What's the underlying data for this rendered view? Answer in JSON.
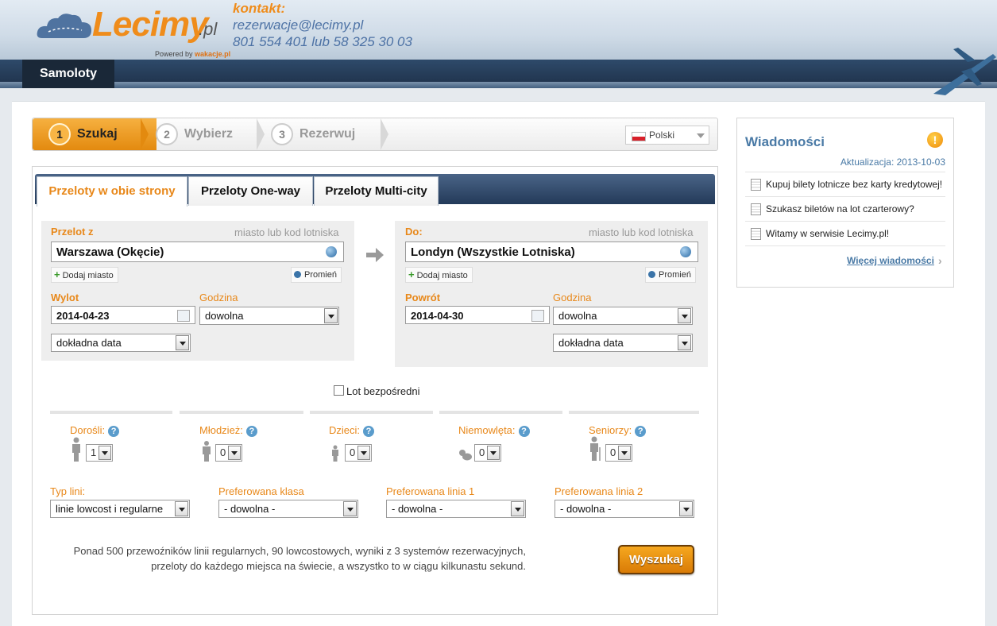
{
  "header": {
    "logo_text": "Lecimy",
    "logo_suffix": ".pl",
    "powered_by": "Powered by",
    "powered_brand": "wakacje.pl",
    "contact_label": "kontakt:",
    "contact_email": "rezerwacje@lecimy.pl",
    "contact_phones": "801 554 401 lub 58 325 30 03"
  },
  "nav": {
    "active_tab": "Samoloty"
  },
  "steps": [
    {
      "num": "1",
      "label": "Szukaj",
      "active": true
    },
    {
      "num": "2",
      "label": "Wybierz",
      "active": false
    },
    {
      "num": "3",
      "label": "Rezerwuj",
      "active": false
    }
  ],
  "language": {
    "selected": "Polski"
  },
  "tabs": [
    "Przeloty w obie strony",
    "Przeloty One-way",
    "Przeloty Multi-city"
  ],
  "from": {
    "label": "Przelot z",
    "hint": "miasto lub kod lotniska",
    "value": "Warszawa (Okęcie)",
    "add_city": "Dodaj miasto",
    "swap": "Promień",
    "date_label": "Wylot",
    "date_value": "2014-04-23",
    "time_label": "Godzina",
    "time_value": "dowolna",
    "precision_value": "dokładna data"
  },
  "to": {
    "label": "Do:",
    "hint": "miasto lub kod lotniska",
    "value": "Londyn (Wszystkie Lotniska)",
    "add_city": "Dodaj miasto",
    "swap": "Promień",
    "date_label": "Powrót",
    "date_value": "2014-04-30",
    "time_label": "Godzina",
    "time_value": "dowolna",
    "precision_value": "dokładna data"
  },
  "direct_flight": {
    "label": "Lot bezpośredni",
    "checked": false
  },
  "passengers": [
    {
      "label": "Dorośli:",
      "value": "1"
    },
    {
      "label": "Młodzież:",
      "value": "0"
    },
    {
      "label": "Dzieci:",
      "value": "0"
    },
    {
      "label": "Niemowlęta:",
      "value": "0"
    },
    {
      "label": "Seniorzy:",
      "value": "0"
    }
  ],
  "options": [
    {
      "label": "Typ lini:",
      "value": "linie lowcost i regularne"
    },
    {
      "label": "Preferowana klasa",
      "value": "- dowolna -"
    },
    {
      "label": "Preferowana linia 1",
      "value": "- dowolna -"
    },
    {
      "label": "Preferowana linia 2",
      "value": "- dowolna -"
    }
  ],
  "description": {
    "line1": "Ponad 500 przewoźników linii regularnych, 90 lowcostowych, wyniki z 3 systemów rezerwacyjnych,",
    "line2": "przeloty do każdego miejsca na świecie, a wszystko to w ciągu kilkunastu sekund."
  },
  "search_button": "Wyszukaj",
  "news": {
    "title": "Wiadomości",
    "updated": "Aktualizacja: 2013-10-03",
    "items": [
      "Kupuj bilety lotnicze bez karty kredytowej!",
      "Szukasz biletów na lot czarterowy?",
      "Witamy w serwisie Lecimy.pl!"
    ],
    "more": "Więcej wiadomości"
  },
  "colors": {
    "accent": "#e8881a",
    "link": "#4a7aa6",
    "nav": "#1e3048"
  }
}
